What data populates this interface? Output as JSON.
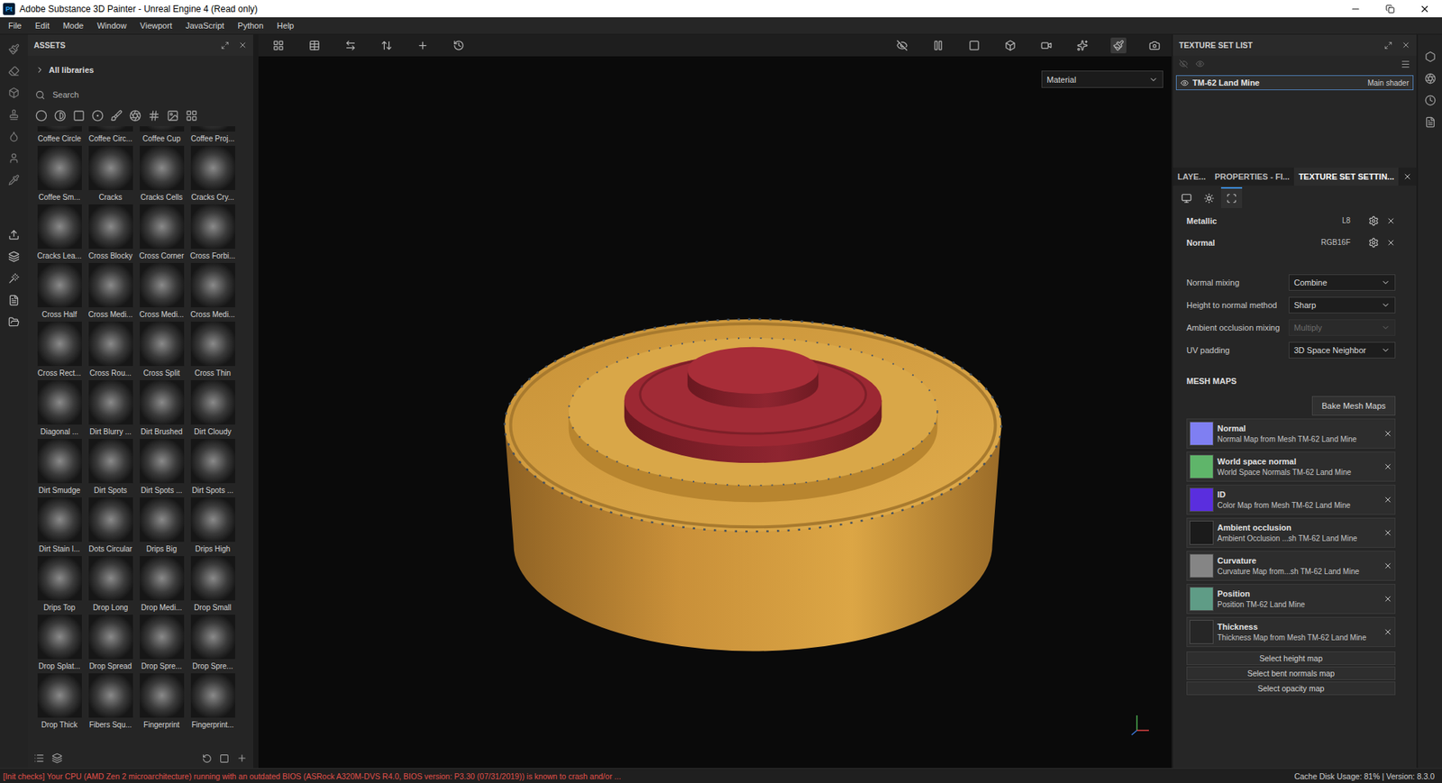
{
  "window": {
    "title": "Adobe Substance 3D Painter - Unreal Engine 4 (Read only)",
    "app_icon": "Pt"
  },
  "menu": [
    "File",
    "Edit",
    "Mode",
    "Window",
    "Viewport",
    "JavaScript",
    "Python",
    "Help"
  ],
  "assets": {
    "title": "ASSETS",
    "library": "All libraries",
    "search_placeholder": "Search",
    "items": [
      "Coffee Circle",
      "Coffee Circ...",
      "Coffee Cup",
      "Coffee Proj...",
      "Coffee Sm...",
      "Cracks",
      "Cracks Cells",
      "Cracks Cry...",
      "Cracks Lea...",
      "Cross Blocky",
      "Cross Corner",
      "Cross Forbi...",
      "Cross Half",
      "Cross Medi...",
      "Cross Medi...",
      "Cross Medi...",
      "Cross Rect...",
      "Cross Rou...",
      "Cross Split",
      "Cross Thin",
      "Diagonal ...",
      "Dirt Blurry ...",
      "Dirt Brushed",
      "Dirt Cloudy",
      "Dirt Smudge",
      "Dirt Spots",
      "Dirt Spots ...",
      "Dirt Spots ...",
      "Dirt Stain l...",
      "Dots Circular",
      "Drips Big",
      "Drips High",
      "Drips Top",
      "Drop Long",
      "Drop Medi...",
      "Drop Small",
      "Drop Splat...",
      "Drop Spread",
      "Drop Spre...",
      "Drop Spre...",
      "Drop Thick",
      "Fibers Squ...",
      "Fingerprint",
      "Fingerprint..."
    ]
  },
  "viewport": {
    "mode_select": "Material"
  },
  "texture_set_list": {
    "title": "TEXTURE SET LIST",
    "sets": [
      {
        "name": "TM-62 Land Mine",
        "shader": "Main shader",
        "selected": true
      }
    ]
  },
  "tabs": [
    {
      "label": "LAYE...",
      "selected": false
    },
    {
      "label": "PROPERTIES - FI...",
      "selected": false
    },
    {
      "label": "TEXTURE SET SETTIN...",
      "selected": true
    }
  ],
  "settings_tabs": [
    {
      "selected": false
    },
    {
      "selected": false
    },
    {
      "selected": true
    }
  ],
  "channels": [
    {
      "name": "Metallic",
      "format": "L8"
    },
    {
      "name": "Normal",
      "format": "RGB16F"
    }
  ],
  "options": [
    {
      "label": "Normal mixing",
      "value": "Combine",
      "disabled": false
    },
    {
      "label": "Height to normal method",
      "value": "Sharp",
      "disabled": false
    },
    {
      "label": "Ambient occlusion mixing",
      "value": "Multiply",
      "disabled": true
    },
    {
      "label": "UV padding",
      "value": "3D Space Neighbor",
      "disabled": false
    }
  ],
  "mesh_maps": {
    "title": "MESH MAPS",
    "bake_button": "Bake Mesh Maps",
    "maps": [
      {
        "name": "Normal",
        "source": "Normal Map from Mesh TM-62 Land Mine",
        "color": "#7f7ff2"
      },
      {
        "name": "World space normal",
        "source": "World Space Normals TM-62 Land Mine",
        "color": "#5fb56a"
      },
      {
        "name": "ID",
        "source": "Color Map from Mesh TM-62 Land Mine",
        "color": "#5a2ede"
      },
      {
        "name": "Ambient occlusion",
        "source": "Ambient Occlusion ...sh TM-62 Land Mine",
        "color": "#1b1b1b"
      },
      {
        "name": "Curvature",
        "source": "Curvature Map from...sh TM-62 Land Mine",
        "color": "#858585"
      },
      {
        "name": "Position",
        "source": "Position TM-62 Land Mine",
        "color": "#5f9c86"
      },
      {
        "name": "Thickness",
        "source": "Thickness Map from Mesh TM-62 Land Mine",
        "color": "#262626"
      }
    ],
    "slots": [
      "Select height map",
      "Select bent normals map",
      "Select opacity map"
    ]
  },
  "status_bar": {
    "message": "[Init checks] Your CPU (AMD Zen 2 microarchitecture) running with an outdated BIOS (ASRock A320M-DVS R4.0, BIOS version: P3.30 (07/31/2019)) is known to crash and/or ...",
    "info": "Cache Disk Usage: 81% | Version: 8.3.0"
  }
}
